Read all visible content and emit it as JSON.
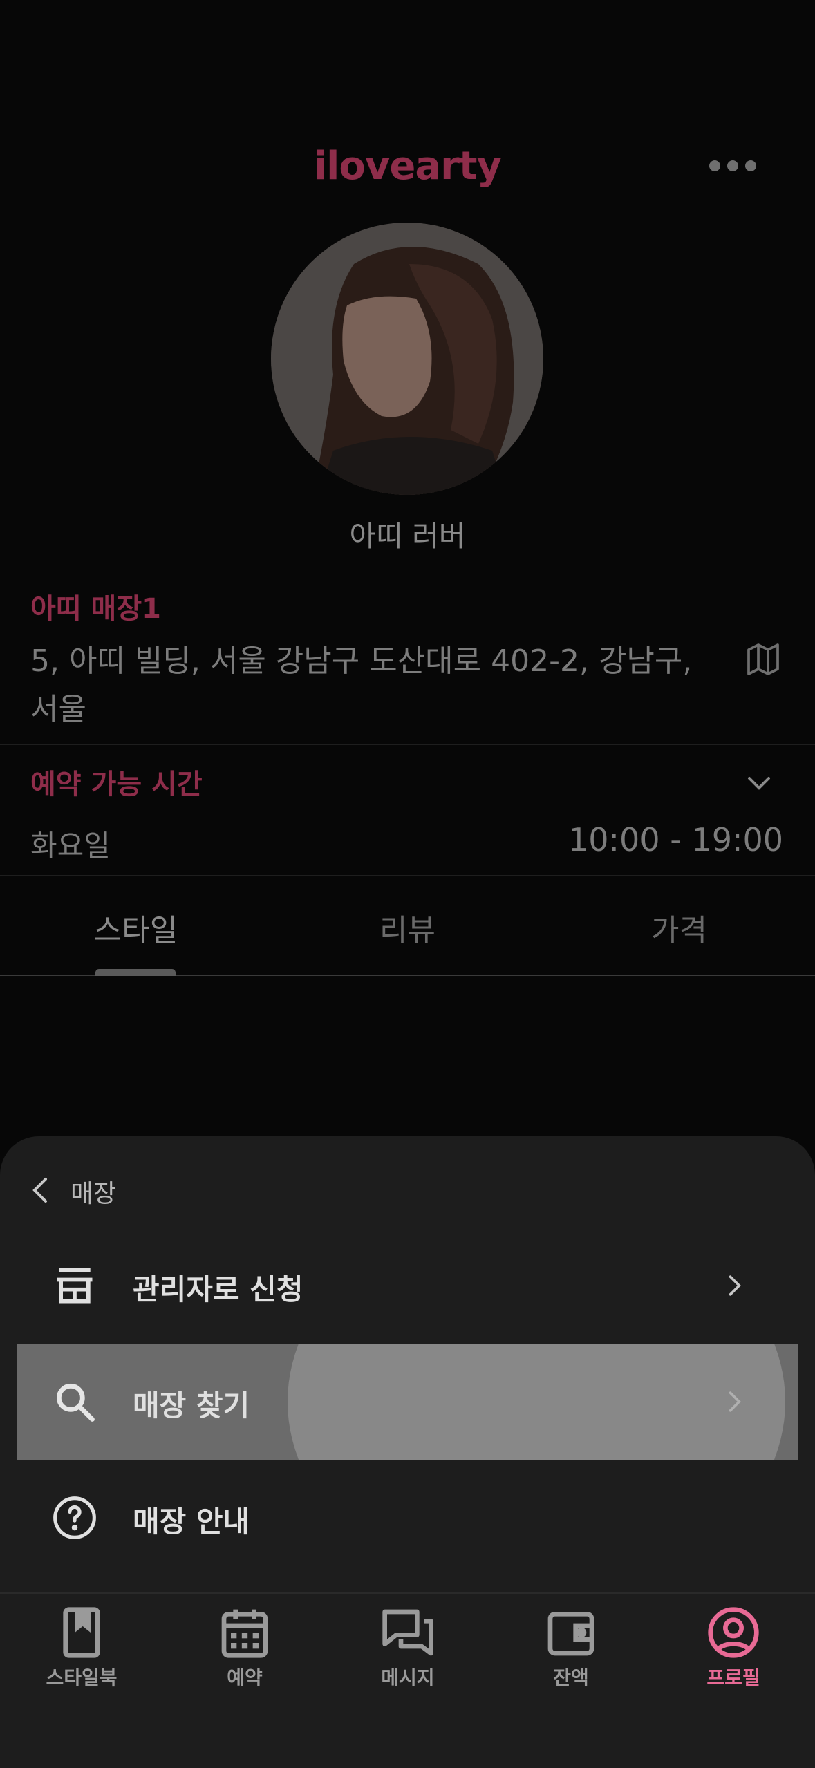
{
  "header": {
    "username": "ilovearty"
  },
  "profile": {
    "display_name": "아띠 러버"
  },
  "store": {
    "name": "아띠 매장1",
    "address": "5, 아띠 빌딩, 서울 강남구 도산대로 402-2, 강남구, 서울"
  },
  "hours": {
    "title": "예약 가능 시간",
    "day": "화요일",
    "time": "10:00 - 19:00"
  },
  "tabs": [
    {
      "label": "스타일"
    },
    {
      "label": "리뷰"
    },
    {
      "label": "가격"
    }
  ],
  "sheet": {
    "title": "매장",
    "items": [
      {
        "label": "관리자로 신청",
        "icon": "store-icon"
      },
      {
        "label": "매장 찾기",
        "icon": "search-icon"
      },
      {
        "label": "매장 안내",
        "icon": "help-icon"
      }
    ]
  },
  "nav": {
    "items": [
      {
        "label": "스타일북",
        "icon": "bookmark-book-icon"
      },
      {
        "label": "예약",
        "icon": "calendar-icon"
      },
      {
        "label": "메시지",
        "icon": "message-icon"
      },
      {
        "label": "잔액",
        "icon": "wallet-icon"
      },
      {
        "label": "프로필",
        "icon": "profile-icon"
      }
    ],
    "active_index": 4
  },
  "colors": {
    "accent": "#8e2d4a",
    "nav_active": "#e86a95",
    "sheet_bg": "#1d1d1d"
  }
}
